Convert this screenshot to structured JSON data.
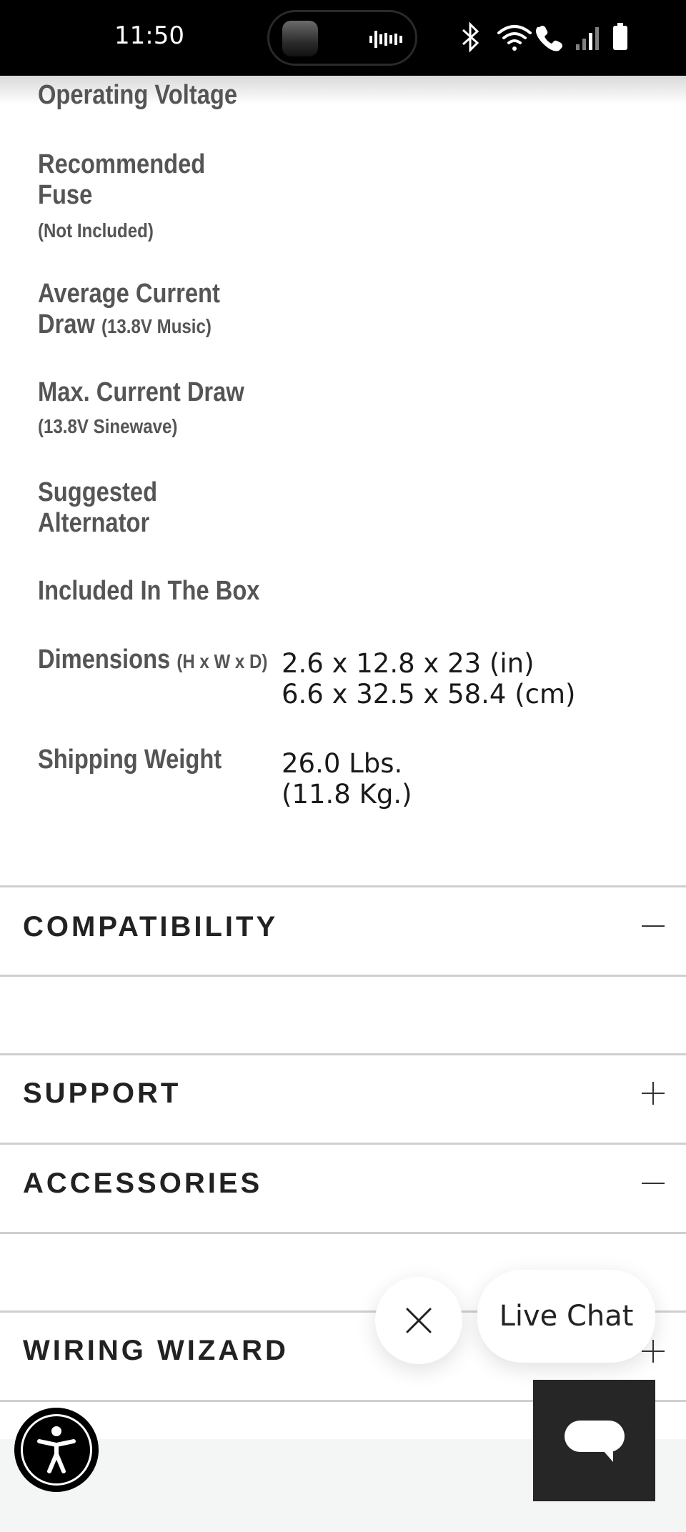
{
  "status_bar": {
    "time": "11:50"
  },
  "specs": [
    {
      "label": "Operating Voltage",
      "sub": "",
      "value": ""
    },
    {
      "label": "Recommended Fuse",
      "sub": "(Not Included)",
      "value": ""
    },
    {
      "label": "Average Current Draw",
      "sub": "(13.8V Music)",
      "value": ""
    },
    {
      "label": "Max. Current Draw",
      "sub": "(13.8V Sinewave)",
      "value": ""
    },
    {
      "label": "Suggested Alternator",
      "sub": "",
      "value": ""
    },
    {
      "label": "Included In The Box",
      "sub": "",
      "value": ""
    },
    {
      "label": "Dimensions",
      "sub": "(H x W x D)",
      "value_line1": "2.6 x 12.8 x 23 (in)",
      "value_line2": "6.6 x 32.5 x 58.4 (cm)"
    },
    {
      "label": "Shipping Weight",
      "sub": "",
      "value_line1": "26.0 Lbs.",
      "value_line2": "(11.8 Kg.)"
    }
  ],
  "accordion": [
    {
      "title": "COMPATIBILITY",
      "state": "expanded"
    },
    {
      "title": "SUPPORT",
      "state": "collapsed"
    },
    {
      "title": "ACCESSORIES",
      "state": "expanded"
    },
    {
      "title": "WIRING WIZARD",
      "state": "collapsed"
    }
  ],
  "chat": {
    "live_chat_label": "Live Chat"
  },
  "icons": {
    "toggle_expanded": "minus-icon",
    "toggle_collapsed": "plus-icon",
    "close": "close-icon",
    "chat": "chat-bubble-icon",
    "accessibility": "accessibility-icon"
  }
}
